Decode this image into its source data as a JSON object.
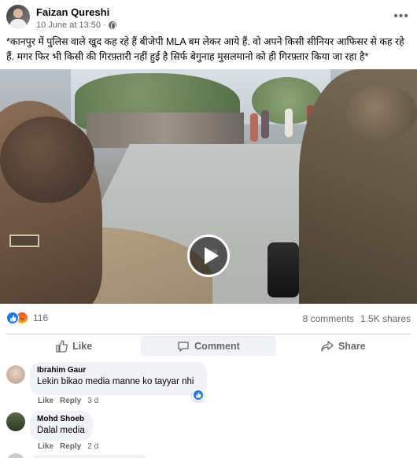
{
  "post": {
    "author": "Faizan Qureshi",
    "timestamp": "10 June at 13:50",
    "separator": "·",
    "privacy_icon": "globe-icon",
    "more_label": "•••",
    "text": "*कानपुर में पुलिस वाले खुद कह रहे हैं बीजेपी MLA बम लेकर आये हैं. वो अपने किसी सीनियर आफिसर से कह रहे हैं. मगर फिर भी किसी की गिरफ़्तारी नहीं हुई है सिर्फ बेगुनाह मुसलमानो को ही गिरफ़्तार किया जा रहा है*"
  },
  "video": {
    "play_icon": "play-icon"
  },
  "stats": {
    "reaction_icons": [
      "like-icon",
      "angry-icon"
    ],
    "reaction_count": "116",
    "comments": "8 comments",
    "shares": "1.5K shares"
  },
  "actions": {
    "like": "Like",
    "comment": "Comment",
    "share": "Share"
  },
  "comments": [
    {
      "name": "Ibrahim Gaur",
      "text": "Lekin bikao media manne ko tayyar nhi",
      "like": "Like",
      "reply": "Reply",
      "time": "3 d",
      "reaction_icon": "like-icon"
    },
    {
      "name": "Mohd Shoeb",
      "text": "Dalal media",
      "like": "Like",
      "reply": "Reply",
      "time": "2 d"
    }
  ],
  "colors": {
    "brand_blue": "#1877f2",
    "secondary_text": "#65676b",
    "bubble_bg": "#f0f2f5"
  }
}
